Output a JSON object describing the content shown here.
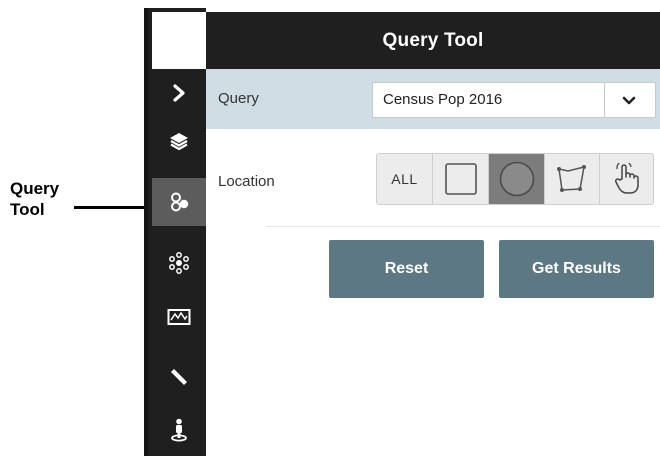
{
  "callout": {
    "line1": "Query",
    "line2": "Tool"
  },
  "panel": {
    "title": "Query Tool",
    "query": {
      "label": "Query",
      "selected": "Census Pop 2016"
    },
    "location": {
      "label": "Location",
      "options": [
        {
          "label": "ALL",
          "icon": "all-text"
        },
        {
          "label": "",
          "icon": "rectangle-icon"
        },
        {
          "label": "",
          "icon": "circle-icon",
          "active": true
        },
        {
          "label": "",
          "icon": "polygon-icon"
        },
        {
          "label": "",
          "icon": "pointer-hand-icon"
        }
      ]
    },
    "buttons": {
      "reset": "Reset",
      "get_results": "Get Results"
    }
  },
  "rail": {
    "items": [
      {
        "icon": "chevron-right-icon"
      },
      {
        "icon": "layers-icon"
      },
      {
        "icon": "query-tool-icon",
        "active": true
      },
      {
        "icon": "network-icon"
      },
      {
        "icon": "map-icon"
      },
      {
        "icon": "ruler-icon"
      },
      {
        "icon": "street-view-icon"
      }
    ]
  },
  "colors": {
    "rail_bg": "#1f1f1f",
    "header_bg": "#1f1f1f",
    "query_row_bg": "#cfdde4",
    "button_bg": "#5d7885",
    "active_segment": "#7c7c7c"
  }
}
